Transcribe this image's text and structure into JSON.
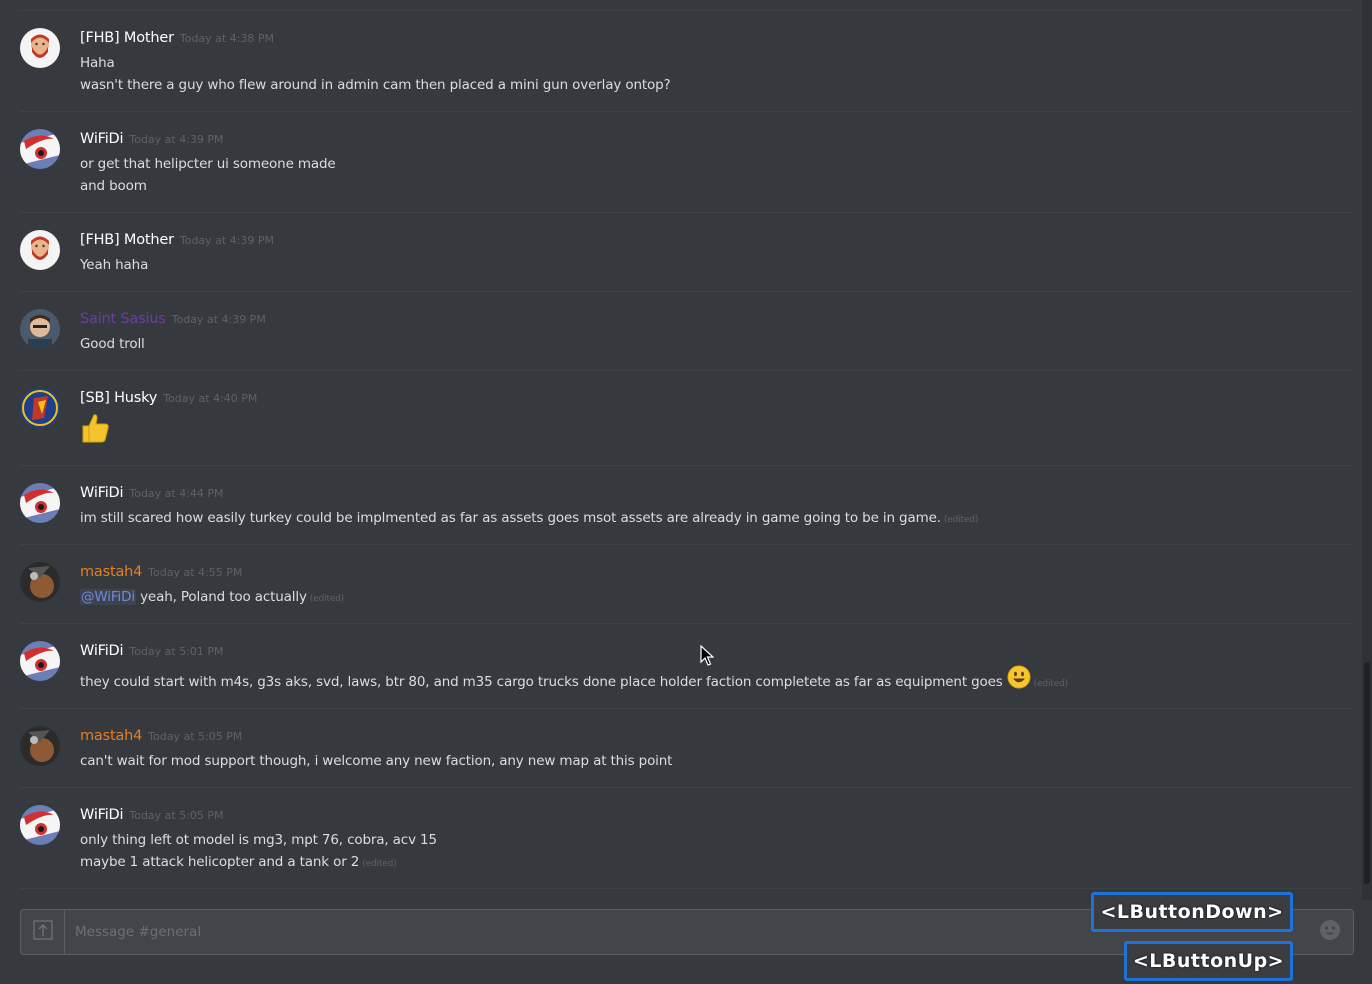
{
  "messages": [
    {
      "avatar": "bearded-man",
      "username": "[FHB] Mother",
      "color": "#ffffff",
      "timestamp": "Today at 4:38 PM",
      "lines": [
        {
          "text": "Haha"
        },
        {
          "text": "wasn't there a guy who flew around in admin cam  then placed a mini gun overlay ontop?"
        }
      ]
    },
    {
      "avatar": "red-white-logo",
      "username": "WiFiDi",
      "color": "#ffffff",
      "timestamp": "Today at 4:39 PM",
      "lines": [
        {
          "text": "or get that helipcter ui someone made"
        },
        {
          "text": "and boom"
        }
      ]
    },
    {
      "avatar": "bearded-man",
      "username": "[FHB] Mother",
      "color": "#ffffff",
      "timestamp": "Today at 4:39 PM",
      "lines": [
        {
          "text": "Yeah haha"
        }
      ]
    },
    {
      "avatar": "photo-face",
      "username": "Saint Sasius",
      "color": "#6b3fa0",
      "timestamp": "Today at 4:39 PM",
      "lines": [
        {
          "text": "Good troll"
        }
      ]
    },
    {
      "avatar": "blue-emblem",
      "username": "[SB] Husky",
      "color": "#ffffff",
      "timestamp": "Today at 4:40 PM",
      "lines": [
        {
          "emoji": "thumbs-up-emoji"
        }
      ]
    },
    {
      "avatar": "red-white-logo",
      "username": "WiFiDi",
      "color": "#ffffff",
      "timestamp": "Today at 4:44 PM",
      "lines": [
        {
          "text": "im still scared how easily turkey could be implmented as far as assets goes msot assets are already in game going to be in game.",
          "edited": "(edited)"
        }
      ]
    },
    {
      "avatar": "dark-photo",
      "username": "mastah4",
      "color": "#e67e22",
      "timestamp": "Today at 4:55 PM",
      "lines": [
        {
          "mention": "@WiFiDi",
          "text": " yeah, Poland too actually",
          "edited": "(edited)"
        }
      ]
    },
    {
      "avatar": "red-white-logo",
      "username": "WiFiDi",
      "color": "#ffffff",
      "timestamp": "Today at 5:01 PM",
      "lines": [
        {
          "text": "they could start with m4s, g3s aks, svd, laws, btr 80, and m35 cargo trucks done place holder faction completete as far as equipment goes",
          "emoji": "smiley-emoji",
          "edited": "(edited)"
        }
      ]
    },
    {
      "avatar": "dark-photo",
      "username": "mastah4",
      "color": "#e67e22",
      "timestamp": "Today at 5:05 PM",
      "lines": [
        {
          "text": "can't wait for mod support though, i welcome any new faction, any new map at this point"
        }
      ]
    },
    {
      "avatar": "red-white-logo",
      "username": "WiFiDi",
      "color": "#ffffff",
      "timestamp": "Today at 5:05 PM",
      "lines": [
        {
          "text": "only thing left ot model is mg3, mpt 76, cobra, acv 15"
        },
        {
          "text": "maybe 1 attack helicopter and a tank or 2",
          "edited": "(edited)"
        }
      ]
    }
  ],
  "composer": {
    "placeholder": "Message #general",
    "value": ""
  },
  "overlays": {
    "down": "<LButtonDown>",
    "up": "<LButtonUp>"
  },
  "icons": {
    "upload": "upload-icon",
    "emoji": "emoji-picker-icon",
    "cursor": "mouse-cursor-icon"
  },
  "colors": {
    "background": "#36393e",
    "mention": "#7289da",
    "overlay_border": "#1e73d9"
  }
}
